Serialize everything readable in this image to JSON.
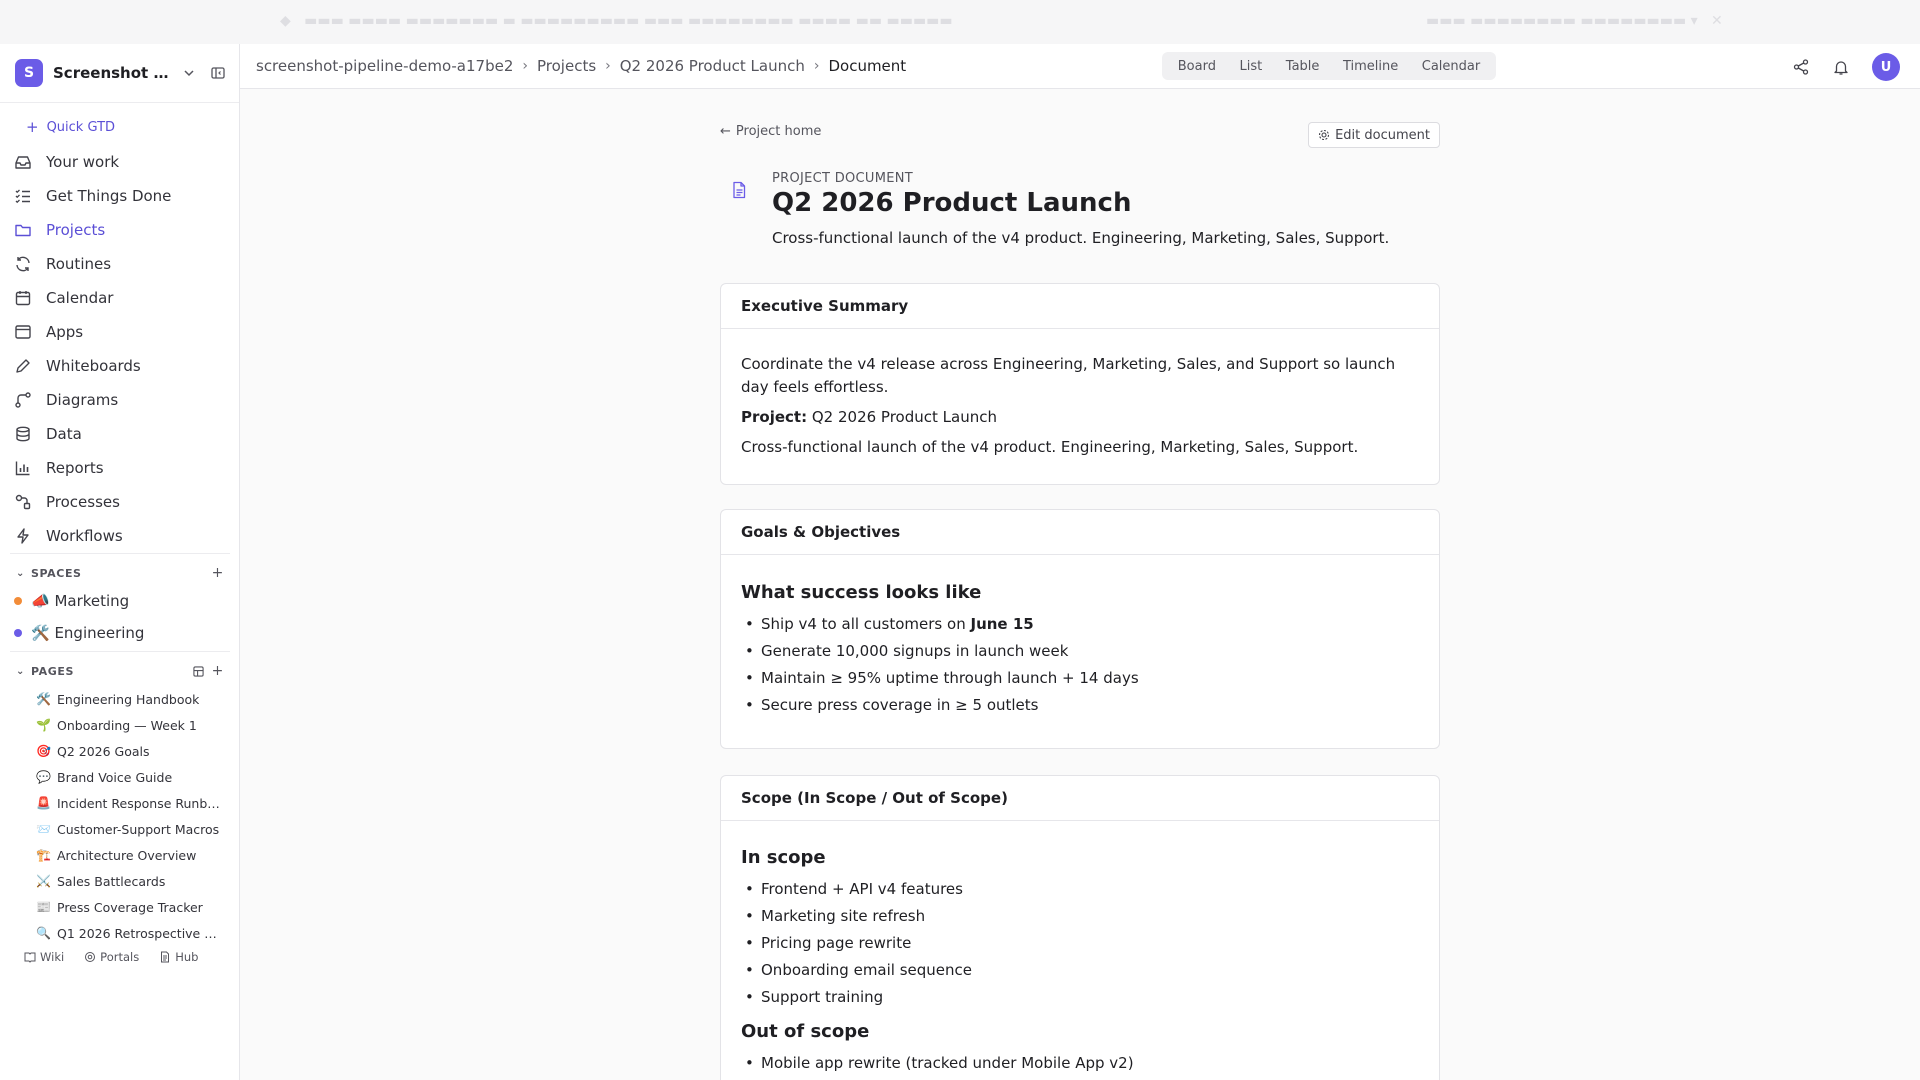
{
  "sidebar": {
    "workspace": {
      "initial": "S",
      "name": "Screenshot Pi..."
    },
    "quick": "Quick GTD",
    "nav": [
      {
        "label": "Your work",
        "icon": "inbox-icon"
      },
      {
        "label": "Get Things Done",
        "icon": "checklist-icon"
      },
      {
        "label": "Projects",
        "icon": "folder-icon",
        "active": true
      },
      {
        "label": "Routines",
        "icon": "refresh-icon"
      },
      {
        "label": "Calendar",
        "icon": "calendar-icon"
      },
      {
        "label": "Apps",
        "icon": "apps-window-icon"
      },
      {
        "label": "Whiteboards",
        "icon": "pencil-icon"
      },
      {
        "label": "Diagrams",
        "icon": "diagram-icon"
      },
      {
        "label": "Data",
        "icon": "database-icon"
      },
      {
        "label": "Reports",
        "icon": "bar-chart-icon"
      },
      {
        "label": "Processes",
        "icon": "process-icon"
      },
      {
        "label": "Workflows",
        "icon": "lightning-icon"
      }
    ],
    "spaces_title": "SPACES",
    "spaces": [
      {
        "label": "📣 Marketing",
        "color": "#f28c38"
      },
      {
        "label": "🛠️ Engineering",
        "color": "#6b5ce7"
      }
    ],
    "pages_title": "PAGES",
    "pages": [
      {
        "emoji": "🛠️",
        "label": "Engineering Handbook"
      },
      {
        "emoji": "🌱",
        "label": "Onboarding — Week 1"
      },
      {
        "emoji": "🎯",
        "label": "Q2 2026 Goals"
      },
      {
        "emoji": "💬",
        "label": "Brand Voice Guide"
      },
      {
        "emoji": "🚨",
        "label": "Incident Response Runbook"
      },
      {
        "emoji": "📨",
        "label": "Customer-Support Macros"
      },
      {
        "emoji": "🏗️",
        "label": "Architecture Overview"
      },
      {
        "emoji": "⚔️",
        "label": "Sales Battlecards"
      },
      {
        "emoji": "📰",
        "label": "Press Coverage Tracker"
      },
      {
        "emoji": "🔍",
        "label": "Q1 2026 Retrospective N..."
      }
    ],
    "bottom_links": [
      "Wiki",
      "Portals",
      "Hub"
    ]
  },
  "header": {
    "breadcrumbs": [
      "screenshot-pipeline-demo-a17be2",
      "Projects",
      "Q2 2026 Product Launch",
      "Document"
    ],
    "views": [
      "Board",
      "List",
      "Table",
      "Timeline",
      "Calendar"
    ],
    "avatar_initial": "U"
  },
  "document": {
    "back_label": "Project home",
    "edit_label": "Edit document",
    "kicker": "PROJECT DOCUMENT",
    "title": "Q2 2026 Product Launch",
    "subtitle": "Cross-functional launch of the v4 product. Engineering, Marketing, Sales, Support.",
    "exec": {
      "title": "Executive Summary",
      "para1": "Coordinate the v4 release across Engineering, Marketing, Sales, and Support so launch day feels effortless.",
      "project_label": "Project:",
      "project_value": "Q2 2026 Product Launch",
      "para2": "Cross-functional launch of the v4 product. Engineering, Marketing, Sales, Support."
    },
    "goals": {
      "title": "Goals & Objectives",
      "heading": "What success looks like",
      "item1_pre": "Ship v4 to all customers on",
      "item1_bold": "June 15",
      "item2": "Generate 10,000 signups in launch week",
      "item3": "Maintain ≥ 95% uptime through launch + 14 days",
      "item4": "Secure press coverage in ≥ 5 outlets"
    },
    "scope": {
      "title": "Scope (In Scope / Out of Scope)",
      "in_heading": "In scope",
      "in_items": [
        "Frontend + API v4 features",
        "Marketing site refresh",
        "Pricing page rewrite",
        "Onboarding email sequence",
        "Support training"
      ],
      "out_heading": "Out of scope",
      "out_items": [
        "Mobile app rewrite (tracked under Mobile App v2)"
      ]
    }
  },
  "colors": {
    "accent": "#6b5ce7",
    "accent_text": "#5b4fd6"
  }
}
